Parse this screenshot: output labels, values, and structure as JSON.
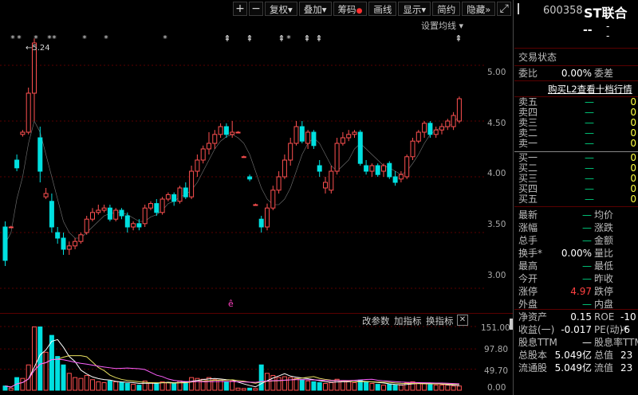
{
  "toolbar": {
    "plus": "+",
    "minus": "−",
    "fq": "复权",
    "overlay": "叠加",
    "chip": "筹码",
    "draw": "画线",
    "display": "显示",
    "brief": "简约",
    "hide": "隐藏",
    "more": "»",
    "expand": "⤢",
    "ma_setting": "设置均线"
  },
  "stock": {
    "code": "600358",
    "name": "ST联合",
    "dash1": "--",
    "dash2": "-"
  },
  "status": {
    "trade_status": "交易状态",
    "wei_bi_label": "委比",
    "wei_bi": "0.00%",
    "wei_cha_label": "委差",
    "link": "购买L2查看十档行情"
  },
  "order_book": {
    "sell": [
      {
        "label": "卖五",
        "p": "—",
        "v": "0"
      },
      {
        "label": "卖四",
        "p": "—",
        "v": "0"
      },
      {
        "label": "卖三",
        "p": "—",
        "v": "0"
      },
      {
        "label": "卖二",
        "p": "—",
        "v": "0"
      },
      {
        "label": "卖一",
        "p": "—",
        "v": "0"
      }
    ],
    "buy": [
      {
        "label": "买一",
        "p": "—",
        "v": "0"
      },
      {
        "label": "买二",
        "p": "—",
        "v": "0"
      },
      {
        "label": "买三",
        "p": "—",
        "v": "0"
      },
      {
        "label": "买四",
        "p": "—",
        "v": "0"
      },
      {
        "label": "买五",
        "p": "—",
        "v": "0"
      }
    ]
  },
  "quote": [
    {
      "l1": "最新",
      "v1": "—",
      "l2": "均价",
      "v2": ""
    },
    {
      "l1": "涨幅",
      "v1": "—",
      "l2": "涨跌",
      "v2": ""
    },
    {
      "l1": "总手",
      "v1": "—",
      "l2": "金额",
      "v2": ""
    },
    {
      "l1": "换手*",
      "v1": "0.00%",
      "l2": "量比",
      "v2": ""
    },
    {
      "l1": "最高",
      "v1": "—",
      "l2": "最低",
      "v2": ""
    },
    {
      "l1": "今开",
      "v1": "—",
      "l2": "昨收",
      "v2": ""
    },
    {
      "l1": "涨停",
      "v1": "4.97",
      "l2": "跌停",
      "v2": ""
    },
    {
      "l1": "外盘",
      "v1": "—",
      "l2": "内盘",
      "v2": ""
    }
  ],
  "fin": [
    {
      "l1": "净资产",
      "v1": "0.15",
      "l2": "ROE",
      "v2": "-10"
    },
    {
      "l1": "收益(一)",
      "v1": "-0.017",
      "l2": "PE(动)*",
      "v2": "-6"
    },
    {
      "l1": "股息TTM",
      "v1": "—",
      "l2": "股息率TTM",
      "v2": ""
    },
    {
      "l1": "总股本",
      "v1": "5.049亿",
      "l2": "总值",
      "v2": "23"
    },
    {
      "l1": "流通股",
      "v1": "5.049亿",
      "l2": "流值",
      "v2": "23"
    }
  ],
  "indicator_bar": {
    "adj": "改参数",
    "add": "加指标",
    "switch": "换指标",
    "close": "✕"
  },
  "axis_price": [
    "5.00",
    "4.50",
    "4.00",
    "3.50",
    "3.00"
  ],
  "axis_vol": [
    "151.00",
    "97.80",
    "49.70",
    "0.00"
  ],
  "max_label": "←5.24",
  "marker": "ê",
  "colors": {
    "up": "#ff5050",
    "down": "#00e0e0",
    "ma5": "#ffffff",
    "ma10": "#e8e060",
    "ma20": "#ff60ff",
    "grid": "#5a0000"
  },
  "chart_data": {
    "type": "candlestick",
    "price_range": [
      2.8,
      5.3
    ],
    "volume_range": [
      0,
      151
    ],
    "candles": [
      {
        "o": 3.55,
        "c": 3.25,
        "h": 3.6,
        "l": 3.2,
        "v": 10
      },
      {
        "o": 3.55,
        "c": 3.55,
        "h": 3.56,
        "l": 3.54,
        "v": 5
      },
      {
        "o": 4.15,
        "c": 4.08,
        "h": 4.2,
        "l": 4.05,
        "v": 30
      },
      {
        "o": 4.38,
        "c": 4.4,
        "h": 4.42,
        "l": 4.36,
        "v": 28
      },
      {
        "o": 4.4,
        "c": 4.75,
        "h": 4.8,
        "l": 4.38,
        "v": 60
      },
      {
        "o": 4.75,
        "c": 5.2,
        "h": 5.24,
        "l": 4.5,
        "v": 150
      },
      {
        "o": 4.35,
        "c": 4.05,
        "h": 4.45,
        "l": 3.95,
        "v": 150
      },
      {
        "o": 3.82,
        "c": 3.85,
        "h": 3.9,
        "l": 3.8,
        "v": 90
      },
      {
        "o": 3.78,
        "c": 3.55,
        "h": 3.85,
        "l": 3.5,
        "v": 130
      },
      {
        "o": 3.5,
        "c": 3.45,
        "h": 3.55,
        "l": 3.4,
        "v": 80
      },
      {
        "o": 3.45,
        "c": 3.35,
        "h": 3.5,
        "l": 3.3,
        "v": 60
      },
      {
        "o": 3.35,
        "c": 3.38,
        "h": 3.42,
        "l": 3.3,
        "v": 40
      },
      {
        "o": 3.38,
        "c": 3.42,
        "h": 3.45,
        "l": 3.35,
        "v": 30
      },
      {
        "o": 3.42,
        "c": 3.48,
        "h": 3.5,
        "l": 3.4,
        "v": 28
      },
      {
        "o": 3.5,
        "c": 3.62,
        "h": 3.65,
        "l": 3.48,
        "v": 35
      },
      {
        "o": 3.62,
        "c": 3.68,
        "h": 3.72,
        "l": 3.6,
        "v": 25
      },
      {
        "o": 3.68,
        "c": 3.7,
        "h": 3.75,
        "l": 3.66,
        "v": 20
      },
      {
        "o": 3.7,
        "c": 3.72,
        "h": 3.75,
        "l": 3.68,
        "v": 18
      },
      {
        "o": 3.72,
        "c": 3.62,
        "h": 3.75,
        "l": 3.6,
        "v": 22
      },
      {
        "o": 3.62,
        "c": 3.7,
        "h": 3.72,
        "l": 3.6,
        "v": 20
      },
      {
        "o": 3.7,
        "c": 3.65,
        "h": 3.72,
        "l": 3.62,
        "v": 18
      },
      {
        "o": 3.65,
        "c": 3.55,
        "h": 3.68,
        "l": 3.5,
        "v": 16
      },
      {
        "o": 3.55,
        "c": 3.58,
        "h": 3.6,
        "l": 3.52,
        "v": 14
      },
      {
        "o": 3.58,
        "c": 3.55,
        "h": 3.62,
        "l": 3.52,
        "v": 12
      },
      {
        "o": 3.58,
        "c": 3.72,
        "h": 3.75,
        "l": 3.55,
        "v": 22
      },
      {
        "o": 3.72,
        "c": 3.76,
        "h": 3.78,
        "l": 3.7,
        "v": 18
      },
      {
        "o": 3.76,
        "c": 3.68,
        "h": 3.8,
        "l": 3.65,
        "v": 16
      },
      {
        "o": 3.68,
        "c": 3.8,
        "h": 3.82,
        "l": 3.66,
        "v": 20
      },
      {
        "o": 3.8,
        "c": 3.84,
        "h": 3.86,
        "l": 3.78,
        "v": 18
      },
      {
        "o": 3.84,
        "c": 3.78,
        "h": 3.86,
        "l": 3.74,
        "v": 16
      },
      {
        "o": 3.78,
        "c": 3.9,
        "h": 3.92,
        "l": 3.76,
        "v": 22
      },
      {
        "o": 3.9,
        "c": 3.82,
        "h": 3.95,
        "l": 3.8,
        "v": 20
      },
      {
        "o": 3.82,
        "c": 4.05,
        "h": 4.1,
        "l": 3.8,
        "v": 30
      },
      {
        "o": 4.05,
        "c": 4.15,
        "h": 4.2,
        "l": 4.0,
        "v": 28
      },
      {
        "o": 4.15,
        "c": 4.25,
        "h": 4.28,
        "l": 4.12,
        "v": 26
      },
      {
        "o": 4.25,
        "c": 4.3,
        "h": 4.4,
        "l": 4.2,
        "v": 30
      },
      {
        "o": 4.3,
        "c": 4.38,
        "h": 4.42,
        "l": 4.25,
        "v": 25
      },
      {
        "o": 4.38,
        "c": 4.45,
        "h": 4.48,
        "l": 4.35,
        "v": 24
      },
      {
        "o": 4.45,
        "c": 4.38,
        "h": 4.48,
        "l": 4.35,
        "v": 20
      },
      {
        "o": 4.38,
        "c": 4.4,
        "h": 4.5,
        "l": 4.35,
        "v": 22
      },
      {
        "o": 4.4,
        "c": 4.4,
        "h": 4.41,
        "l": 4.39,
        "v": 5
      },
      {
        "o": 4.18,
        "c": 4.18,
        "h": 4.19,
        "l": 4.17,
        "v": 4
      },
      {
        "o": 4.0,
        "c": 3.98,
        "h": 4.02,
        "l": 3.96,
        "v": 5
      },
      {
        "o": 3.75,
        "c": 3.75,
        "h": 3.76,
        "l": 3.74,
        "v": 4
      },
      {
        "o": 3.62,
        "c": 3.55,
        "h": 3.65,
        "l": 3.5,
        "v": 60
      },
      {
        "o": 3.55,
        "c": 3.72,
        "h": 3.76,
        "l": 3.52,
        "v": 40
      },
      {
        "o": 3.72,
        "c": 3.88,
        "h": 3.92,
        "l": 3.7,
        "v": 35
      },
      {
        "o": 3.88,
        "c": 4.0,
        "h": 4.05,
        "l": 3.85,
        "v": 30
      },
      {
        "o": 4.0,
        "c": 4.15,
        "h": 4.2,
        "l": 3.98,
        "v": 32
      },
      {
        "o": 4.15,
        "c": 4.3,
        "h": 4.35,
        "l": 4.1,
        "v": 30
      },
      {
        "o": 4.3,
        "c": 4.45,
        "h": 4.5,
        "l": 4.28,
        "v": 28
      },
      {
        "o": 4.45,
        "c": 4.32,
        "h": 4.5,
        "l": 4.3,
        "v": 25
      },
      {
        "o": 4.3,
        "c": 4.4,
        "h": 4.42,
        "l": 4.25,
        "v": 22
      },
      {
        "o": 4.4,
        "c": 4.28,
        "h": 4.42,
        "l": 4.25,
        "v": 20
      },
      {
        "o": 4.1,
        "c": 4.05,
        "h": 4.15,
        "l": 4.0,
        "v": 18
      },
      {
        "o": 3.9,
        "c": 3.95,
        "h": 4.0,
        "l": 3.85,
        "v": 16
      },
      {
        "o": 3.88,
        "c": 4.05,
        "h": 4.1,
        "l": 3.85,
        "v": 18
      },
      {
        "o": 4.05,
        "c": 4.3,
        "h": 4.35,
        "l": 4.02,
        "v": 26
      },
      {
        "o": 4.3,
        "c": 4.35,
        "h": 4.4,
        "l": 4.28,
        "v": 22
      },
      {
        "o": 4.35,
        "c": 4.38,
        "h": 4.42,
        "l": 4.32,
        "v": 20
      },
      {
        "o": 4.38,
        "c": 4.4,
        "h": 4.42,
        "l": 4.35,
        "v": 18
      },
      {
        "o": 4.4,
        "c": 4.12,
        "h": 4.42,
        "l": 4.1,
        "v": 24
      },
      {
        "o": 4.1,
        "c": 4.05,
        "h": 4.15,
        "l": 4.02,
        "v": 20
      },
      {
        "o": 4.05,
        "c": 4.1,
        "h": 4.12,
        "l": 4.0,
        "v": 16
      },
      {
        "o": 4.1,
        "c": 4.02,
        "h": 4.12,
        "l": 4.0,
        "v": 14
      },
      {
        "o": 4.05,
        "c": 4.1,
        "h": 4.12,
        "l": 4.0,
        "v": 12
      },
      {
        "o": 4.12,
        "c": 4.0,
        "h": 4.14,
        "l": 3.98,
        "v": 14
      },
      {
        "o": 4.0,
        "c": 3.95,
        "h": 4.05,
        "l": 3.92,
        "v": 12
      },
      {
        "o": 3.98,
        "c": 4.02,
        "h": 4.05,
        "l": 3.95,
        "v": 12
      },
      {
        "o": 4.0,
        "c": 4.18,
        "h": 4.2,
        "l": 3.98,
        "v": 18
      },
      {
        "o": 4.18,
        "c": 4.32,
        "h": 4.35,
        "l": 4.15,
        "v": 20
      },
      {
        "o": 4.32,
        "c": 4.4,
        "h": 4.42,
        "l": 4.3,
        "v": 18
      },
      {
        "o": 4.4,
        "c": 4.48,
        "h": 4.5,
        "l": 4.35,
        "v": 16
      },
      {
        "o": 4.48,
        "c": 4.38,
        "h": 4.5,
        "l": 4.35,
        "v": 14
      },
      {
        "o": 4.38,
        "c": 4.42,
        "h": 4.45,
        "l": 4.35,
        "v": 12
      },
      {
        "o": 4.42,
        "c": 4.45,
        "h": 4.48,
        "l": 4.38,
        "v": 12
      },
      {
        "o": 4.45,
        "c": 4.5,
        "h": 4.52,
        "l": 4.42,
        "v": 12
      },
      {
        "o": 4.45,
        "c": 4.55,
        "h": 4.58,
        "l": 4.42,
        "v": 10
      },
      {
        "o": 4.5,
        "c": 4.7,
        "h": 4.72,
        "l": 4.48,
        "v": 10
      }
    ],
    "ma5": [
      3.4,
      3.5,
      3.8,
      4.0,
      4.3,
      4.5,
      4.4,
      4.2,
      4.0,
      3.8,
      3.6,
      3.5,
      3.45,
      3.45,
      3.5,
      3.55,
      3.6,
      3.65,
      3.67,
      3.68,
      3.68,
      3.66,
      3.63,
      3.6,
      3.6,
      3.64,
      3.66,
      3.7,
      3.76,
      3.78,
      3.82,
      3.84,
      3.88,
      3.95,
      4.05,
      4.15,
      4.25,
      4.32,
      4.36,
      4.38,
      4.35,
      4.3,
      4.2,
      4.05,
      3.9,
      3.8,
      3.75,
      3.75,
      3.8,
      3.9,
      4.05,
      4.2,
      4.3,
      4.35,
      4.3,
      4.2,
      4.1,
      4.05,
      4.1,
      4.15,
      4.25,
      4.3,
      4.25,
      4.2,
      4.15,
      4.1,
      4.08,
      4.05,
      4.02,
      4.05,
      4.12,
      4.2,
      4.3,
      4.38,
      4.42,
      4.44,
      4.45,
      4.48,
      4.55
    ]
  }
}
